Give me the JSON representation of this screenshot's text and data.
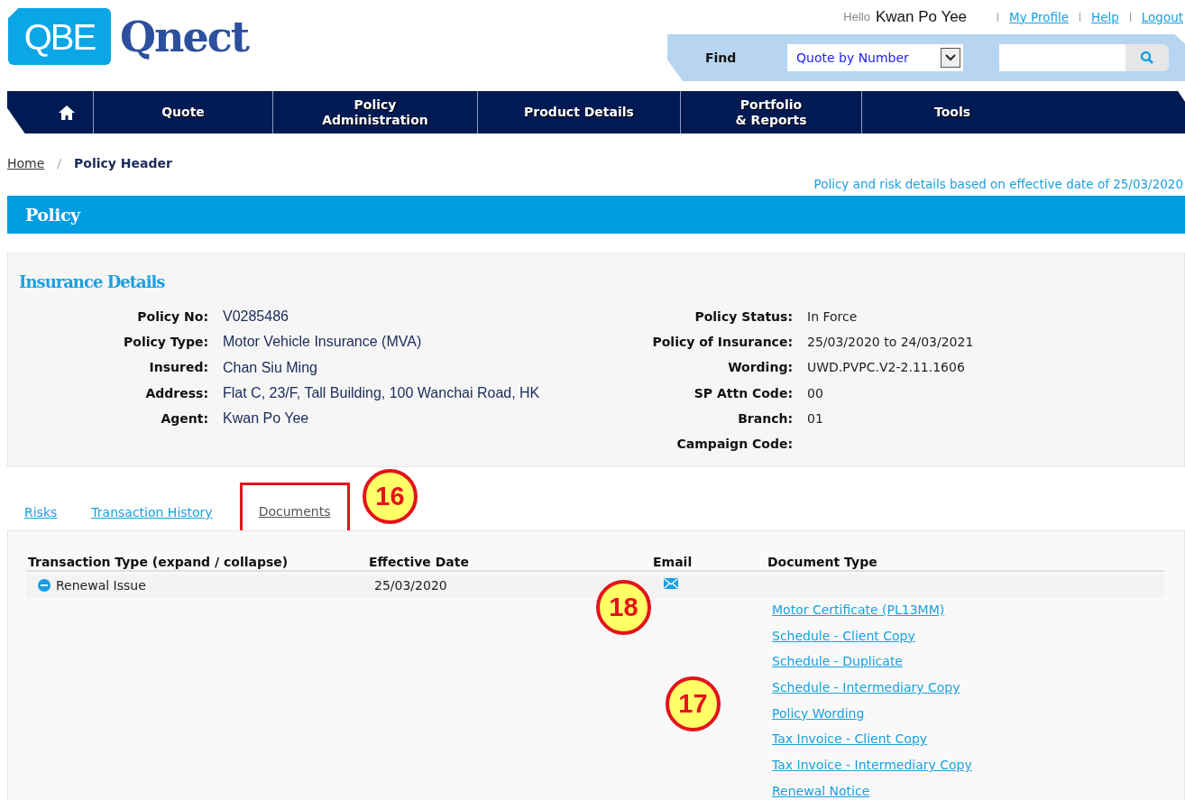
{
  "logo": {
    "badge": "QBE",
    "name": "Qnect"
  },
  "user_bar": {
    "greeting": "Hello",
    "user_name": "Kwan Po Yee",
    "links": [
      "My Profile",
      "Help",
      "Logout"
    ]
  },
  "find": {
    "label": "Find",
    "select_value": "Quote by Number"
  },
  "nav": [
    {
      "kind": "home"
    },
    {
      "kind": "text",
      "lines": [
        "Quote"
      ]
    },
    {
      "kind": "text",
      "lines": [
        "Policy",
        "Administration"
      ]
    },
    {
      "kind": "text",
      "lines": [
        "Product Details"
      ]
    },
    {
      "kind": "text",
      "lines": [
        "Portfolio",
        "& Reports"
      ]
    },
    {
      "kind": "text",
      "lines": [
        "Tools"
      ]
    }
  ],
  "breadcrumb": {
    "link": "Home",
    "separator": "/",
    "current": "Policy Header"
  },
  "effective_note": "Policy and risk details based on effective date of 25/03/2020",
  "section_title": "Policy",
  "insurance_details": {
    "title": "Insurance Details",
    "left": [
      {
        "label": "Policy No:",
        "value": "V0285486"
      },
      {
        "label": "Policy Type:",
        "value": "Motor Vehicle Insurance (MVA)"
      },
      {
        "label": "Insured:",
        "value": "Chan Siu Ming"
      },
      {
        "label": "Address:",
        "value": "Flat C, 23/F, Tall Building, 100 Wanchai Road, HK"
      },
      {
        "label": "Agent:",
        "value": "Kwan Po Yee"
      }
    ],
    "right": [
      {
        "label": "Policy Status:",
        "value": "In Force"
      },
      {
        "label": "Policy of Insurance:",
        "value": "25/03/2020 to 24/03/2021"
      },
      {
        "label": "Wording:",
        "value": "UWD.PVPC.V2-2.11.1606"
      },
      {
        "label": "SP Attn Code:",
        "value": "00"
      },
      {
        "label": "Branch:",
        "value": "01"
      },
      {
        "label": "Campaign Code:"
      }
    ]
  },
  "tabs": [
    {
      "label": "Risks",
      "selected": false,
      "highlighted": false
    },
    {
      "label": "Transaction History",
      "selected": false,
      "highlighted": false
    },
    {
      "label": "Documents",
      "selected": true,
      "highlighted": true
    }
  ],
  "table": {
    "columns": [
      "Transaction Type (expand / collapse)",
      "Effective Date",
      "Email",
      "Document Type"
    ],
    "rows": [
      {
        "type": "Renewal Issue",
        "expanded": true,
        "effective_date": "25/03/2020",
        "documents": [
          "Motor Certificate (PL13MM)",
          "Schedule - Client Copy",
          "Schedule - Duplicate",
          "Schedule - Intermediary Copy",
          "Policy Wording",
          "Tax Invoice - Client Copy",
          "Tax Invoice - Intermediary Copy",
          "Renewal Notice"
        ]
      }
    ]
  },
  "callouts": [
    {
      "label": "16"
    },
    {
      "label": "18"
    },
    {
      "label": "17"
    }
  ]
}
